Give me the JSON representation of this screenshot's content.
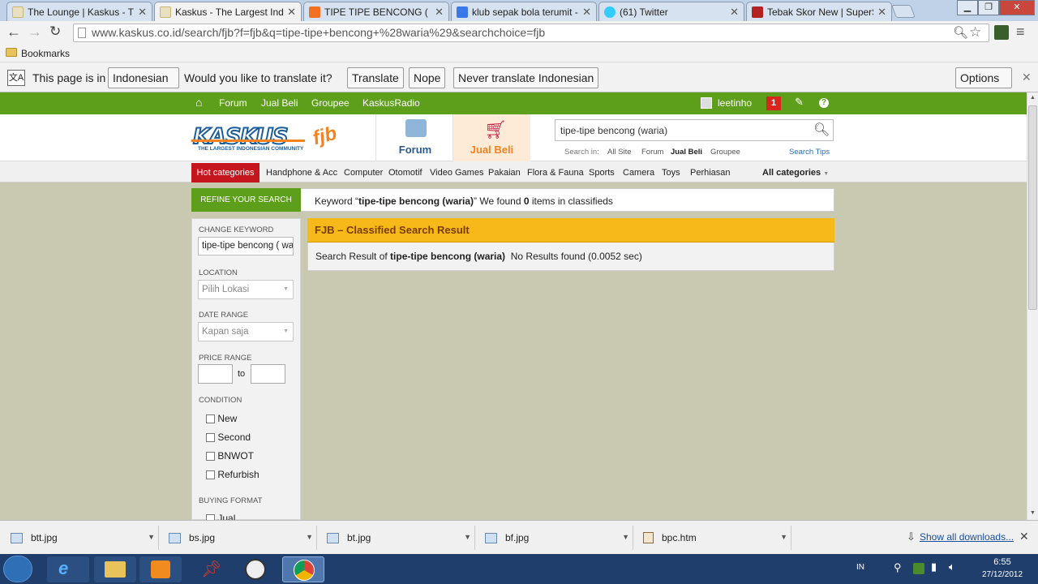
{
  "browser": {
    "tabs": [
      {
        "title": "The Lounge | Kaskus - The",
        "active": false
      },
      {
        "title": "Kaskus - The Largest Indo",
        "active": true
      },
      {
        "title": "TIPE TIPE BENCONG ( WA",
        "active": false
      },
      {
        "title": "klub sepak bola terumit - ",
        "active": false
      },
      {
        "title": "(61) Twitter",
        "active": false
      },
      {
        "title": "Tebak Skor New | SuperSo",
        "active": false
      }
    ],
    "url": "www.kaskus.co.id/search/fjb?f=fjb&q=tipe-tipe+bencong+%28waria%29&searchchoice=fjb",
    "bookmarks_label": "Bookmarks"
  },
  "translate": {
    "prefix": "This page is in",
    "language": "Indonesian",
    "question": "Would you like to translate it?",
    "translate_btn": "Translate",
    "nope_btn": "Nope",
    "never_btn": "Never translate Indonesian",
    "options_btn": "Options"
  },
  "nav": {
    "items": [
      "Forum",
      "Jual Beli",
      "Groupee",
      "KaskusRadio"
    ],
    "username": "leetinho",
    "notif_count": "1"
  },
  "header": {
    "logo_text": "KASKUS",
    "logo_tagline": "THE LARGEST INDONESIAN COMMUNITY",
    "logo_badge": "fjb",
    "forum_label": "Forum",
    "jualbeli_label": "Jual Beli",
    "search_value": "tipe-tipe bencong (waria)",
    "search_in_label": "Search in:",
    "search_in_options": [
      "All Site",
      "Forum",
      "Jual Beli",
      "Groupee"
    ],
    "search_tips": "Search Tips"
  },
  "categories": {
    "hot": "Hot categories",
    "items": [
      "Handphone & Acc",
      "Computer",
      "Otomotif",
      "Video Games",
      "Pakaian",
      "Flora & Fauna",
      "Sports",
      "Camera",
      "Toys",
      "Perhiasan"
    ],
    "all": "All categories"
  },
  "refine": {
    "label": "REFINE YOUR SEARCH",
    "keyword_prefix": "Keyword “",
    "keyword": "tipe-tipe bencong (waria)",
    "keyword_suffix": "” We found ",
    "count": "0",
    "count_suffix": " items in classifieds"
  },
  "sidebar": {
    "change_keyword_label": "CHANGE KEYWORD",
    "keyword_value": "tipe-tipe bencong ( wa",
    "location_label": "LOCATION",
    "location_value": "Pilih Lokasi",
    "date_label": "DATE RANGE",
    "date_value": "Kapan saja",
    "price_label": "PRICE RANGE",
    "price_to": "to",
    "condition_label": "CONDITION",
    "conditions": [
      "New",
      "Second",
      "BNWOT",
      "Refurbish"
    ],
    "buying_label": "BUYING FORMAT",
    "buying_options": [
      "Jual"
    ]
  },
  "results": {
    "title": "FJB – Classified Search Result",
    "prefix": "Search Result of ",
    "keyword": "tipe-tipe bencong (waria)",
    "suffix": "  No Results found (0.0052 sec)"
  },
  "downloads": {
    "files": [
      "btt.jpg",
      "bs.jpg",
      "bt.jpg",
      "bf.jpg",
      "bpc.htm"
    ],
    "show_all": "Show all downloads..."
  },
  "taskbar": {
    "lang": "IN",
    "time": "6:55",
    "date": "27/12/2012"
  },
  "colors": {
    "kaskus_green": "#5d9f1a",
    "hot_red": "#c4161c",
    "result_header": "#f6b919",
    "main_bg": "#c9c9b1"
  }
}
